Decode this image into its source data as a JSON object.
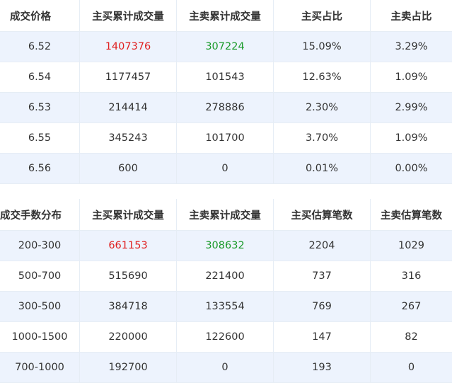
{
  "price_table": {
    "headers": [
      "成交价格",
      "主买累计成交量",
      "主卖累计成交量",
      "主买占比",
      "主卖占比"
    ],
    "rows": [
      [
        "6.52",
        "1407376",
        "307224",
        "15.09%",
        "3.29%"
      ],
      [
        "6.54",
        "1177457",
        "101543",
        "12.63%",
        "1.09%"
      ],
      [
        "6.53",
        "214414",
        "278886",
        "2.30%",
        "2.99%"
      ],
      [
        "6.55",
        "345243",
        "101700",
        "3.70%",
        "1.09%"
      ],
      [
        "6.56",
        "600",
        "0",
        "0.01%",
        "0.00%"
      ]
    ]
  },
  "lot_table": {
    "headers": [
      "成交手数分布",
      "主买累计成交量",
      "主卖累计成交量",
      "主买估算笔数",
      "主卖估算笔数"
    ],
    "rows": [
      [
        "200-300",
        "661153",
        "308632",
        "2204",
        "1029"
      ],
      [
        "500-700",
        "515690",
        "221400",
        "737",
        "316"
      ],
      [
        "300-500",
        "384718",
        "133554",
        "769",
        "267"
      ],
      [
        "1000-1500",
        "220000",
        "122600",
        "147",
        "82"
      ],
      [
        "700-1000",
        "192700",
        "0",
        "193",
        "0"
      ]
    ]
  },
  "colors": {
    "max_buy": "#e02020",
    "max_sell": "#1a9a2a",
    "row_alt_bg": "#edf3fd",
    "border": "#e6edf5"
  }
}
